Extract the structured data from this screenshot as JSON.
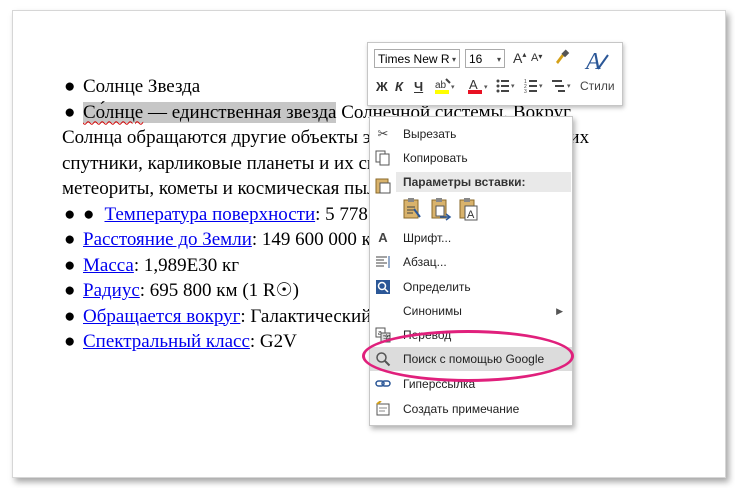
{
  "document": {
    "line1": {
      "bullet": "●",
      "text": "Солнце Звезда"
    },
    "line2": {
      "bullet": "●",
      "word": "Со́лнце",
      "selected_rest": " — единственная звезда",
      "rest": " Солнечной системы. Вокруг"
    },
    "para_lines": [
      "Солнца обращаются другие объекты этой системы: планеты и их",
      "спутники, карликовые планеты и их спутники, астероиды,",
      "метеориты, кометы и космическая пыль."
    ],
    "items": [
      {
        "bullet": "●",
        "inner_bullet": "●",
        "link": "Температура поверхности",
        "value": ": 5 778 K"
      },
      {
        "bullet": "●",
        "link": "Расстояние до Земли",
        "value": ": 149 600 000 км"
      },
      {
        "bullet": "●",
        "link": "Масса",
        "value": ": 1,989E30 кг"
      },
      {
        "bullet": "●",
        "link": "Радиус",
        "value": ": 695 800 км (1 R☉)"
      },
      {
        "bullet": "●",
        "link": "Обращается вокруг",
        "value": ": Галактический центр"
      },
      {
        "bullet": "●",
        "link": "Спектральный класс",
        "value": ": G2V"
      }
    ]
  },
  "mini_toolbar": {
    "font_name": "Times New Roi",
    "font_size": "16",
    "bold": "Ж",
    "italic": "К",
    "underline": "Ч",
    "styles_label": "Стили"
  },
  "context_menu": {
    "cut": "Вырезать",
    "copy": "Копировать",
    "paste_header": "Параметры вставки:",
    "font": "Шрифт...",
    "paragraph": "Абзац...",
    "define": "Определить",
    "synonyms": "Синонимы",
    "translate": "Перевод",
    "google_search": "Поиск с помощью Google",
    "hyperlink": "Гиперссылка",
    "new_comment": "Создать примечание"
  },
  "colors": {
    "highlight_ring": "#e0207c",
    "link": "#0000ee",
    "selection": "#c6c6c6"
  }
}
